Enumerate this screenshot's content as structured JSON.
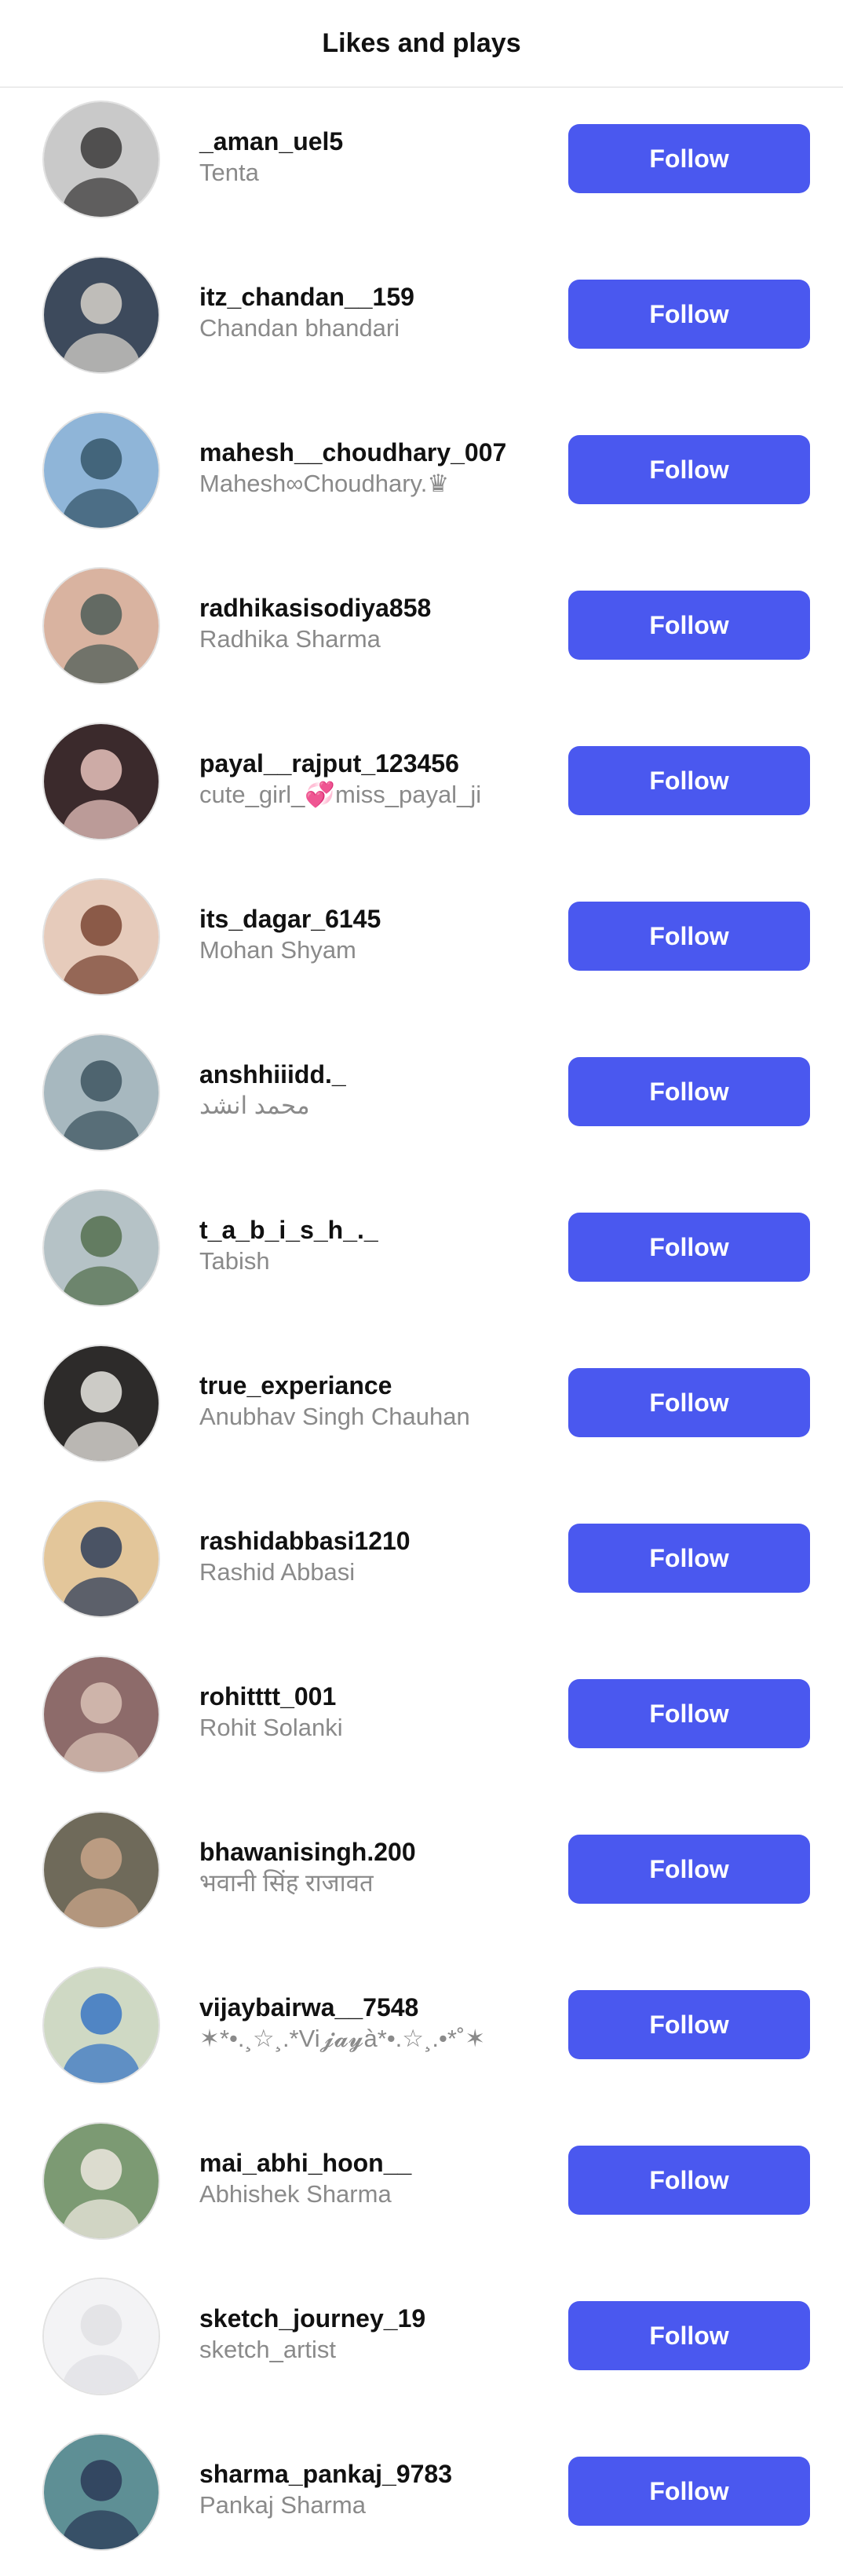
{
  "header": {
    "title": "Likes and plays"
  },
  "accent_color": "#4a58ef",
  "users": [
    {
      "username": "_aman_uel5",
      "full_name": "Tenta",
      "follow_label": "Follow",
      "bg": "#c9c9c9",
      "fg": "#3b3a3a"
    },
    {
      "username": "itz_chandan__159",
      "full_name": "Chandan bhandari",
      "follow_label": "Follow",
      "bg": "#3d4a5c",
      "fg": "#d6d1c9"
    },
    {
      "username": "mahesh__choudhary_007",
      "full_name": "Mahesh∞Choudhary.♛",
      "follow_label": "Follow",
      "bg": "#8fb5d8",
      "fg": "#36576b"
    },
    {
      "username": "radhikasisodiya858",
      "full_name": "Radhika Sharma",
      "follow_label": "Follow",
      "bg": "#d9b3a0",
      "fg": "#4e5d58"
    },
    {
      "username": "payal__rajput_123456",
      "full_name": "cute_girl_💞miss_payal_ji",
      "follow_label": "Follow",
      "bg": "#3b2a2c",
      "fg": "#e7c2bc"
    },
    {
      "username": "its_dagar_6145",
      "full_name": "Mohan Shyam",
      "follow_label": "Follow",
      "bg": "#e6cbbb",
      "fg": "#7a4634"
    },
    {
      "username": "anshhiiidd._",
      "full_name": "محمد انشد",
      "follow_label": "Follow",
      "bg": "#a7b8bf",
      "fg": "#3e5560"
    },
    {
      "username": "t_a_b_i_s_h_._",
      "full_name": "Tabish",
      "follow_label": "Follow",
      "bg": "#b5c2c6",
      "fg": "#55704f"
    },
    {
      "username": "true_experiance",
      "full_name": "Anubhav Singh Chauhan",
      "follow_label": "Follow",
      "bg": "#2d2b2a",
      "fg": "#e9e7e2"
    },
    {
      "username": "rashidabbasi1210",
      "full_name": "Rashid Abbasi",
      "follow_label": "Follow",
      "bg": "#e3c69a",
      "fg": "#2f3e5a"
    },
    {
      "username": "rohitttt_001",
      "full_name": "Rohit Solanki",
      "follow_label": "Follow",
      "bg": "#8d6b6a",
      "fg": "#d9c1b5"
    },
    {
      "username": "bhawanisingh.200",
      "full_name": "भवानी सिंह राजावत",
      "follow_label": "Follow",
      "bg": "#6f6a5a",
      "fg": "#c9a58a"
    },
    {
      "username": "vijaybairwa__7548",
      "full_name": "✶*•.¸☆¸.*Vi𝓳𝓪𝔂à*•.☆¸.•*˚✶",
      "follow_label": "Follow",
      "bg": "#cfd9c4",
      "fg": "#3a76c4"
    },
    {
      "username": "mai_abhi_hoon__",
      "full_name": "Abhishek Sharma",
      "follow_label": "Follow",
      "bg": "#7c9a73",
      "fg": "#ede8df"
    },
    {
      "username": "sketch_journey_19",
      "full_name": "sketch_artist",
      "follow_label": "Follow",
      "bg": "#f3f3f5",
      "fg": "#e0e0e4"
    },
    {
      "username": "sharma_pankaj_9783",
      "full_name": "Pankaj Sharma",
      "follow_label": "Follow",
      "bg": "#5e8f95",
      "fg": "#2b3b58"
    }
  ]
}
